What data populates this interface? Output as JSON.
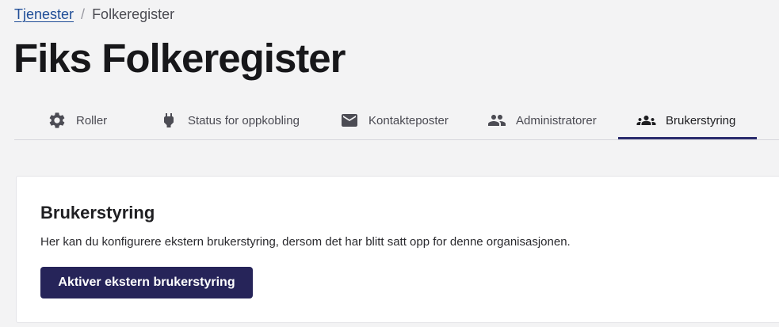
{
  "breadcrumb": {
    "link_label": "Tjenester",
    "separator": "/",
    "current": "Folkeregister"
  },
  "page": {
    "title": "Fiks Folkeregister"
  },
  "tabs": [
    {
      "label": "Roller",
      "icon": "gear-icon",
      "active": false
    },
    {
      "label": "Status for oppkobling",
      "icon": "plug-icon",
      "active": false
    },
    {
      "label": "Kontakteposter",
      "icon": "mail-icon",
      "active": false
    },
    {
      "label": "Administratorer",
      "icon": "people-icon",
      "active": false
    },
    {
      "label": "Brukerstyring",
      "icon": "groups-icon",
      "active": true
    }
  ],
  "card": {
    "title": "Brukerstyring",
    "description": "Her kan du konfigurere ekstern brukerstyring, dersom det har blitt satt opp for denne organisasjonen.",
    "button_label": "Aktiver ekstern brukerstyring"
  },
  "colors": {
    "accent": "#262459",
    "link": "#1f4d97",
    "background": "#f3f3f4"
  }
}
